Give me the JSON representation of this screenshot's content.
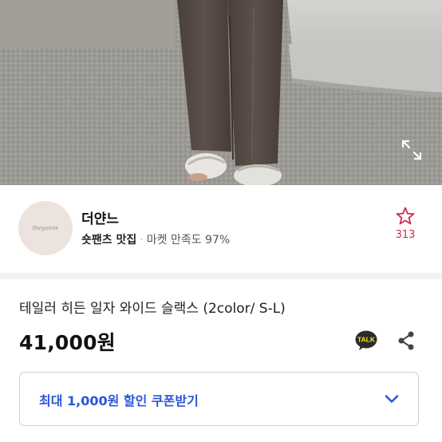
{
  "product_image": {
    "expand_icon": "expand-icon",
    "alt": ""
  },
  "seller": {
    "avatar_text": "theyanne",
    "name": "더얀느",
    "tagline": "숏팬츠 맛집",
    "separator": "·",
    "satisfaction_label": "마켓 만족도",
    "satisfaction_value": "97%",
    "favorite_icon": "star-outline-icon",
    "favorite_count": "313"
  },
  "product": {
    "title": "테일러 히든 일자 와이드 슬랙스 (2color/ S-L)",
    "price": "41,000원",
    "talk_icon_label": "TALK",
    "share_icon": "share-icon"
  },
  "coupon": {
    "label": "최대 1,000원 할인 쿠폰받기",
    "chevron_icon": "chevron-down-icon"
  },
  "colors": {
    "accent_blue": "#2b56d8",
    "favorite_red": "#c9304e",
    "kakao_yellow": "#ffe812"
  }
}
